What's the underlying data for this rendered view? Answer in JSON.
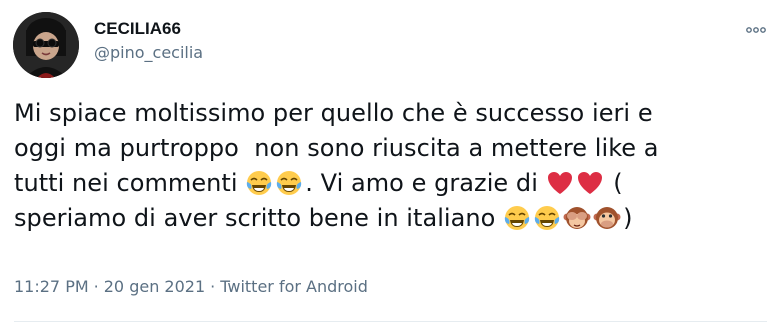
{
  "tweet": {
    "author": {
      "display_name": "CECILIA66",
      "handle": "@pino_cecilia",
      "avatar_icon": "avatar-icon"
    },
    "text_segments": {
      "line1": "Mi spiace moltissimo per quello che è successo ieri e",
      "line2": "oggi ma purtroppo  non sono riuscita a mettere like a",
      "line3a": "tutti nei commenti ",
      "line3b": ". Vi amo e grazie di ",
      "line3c": " (",
      "line4a": "speriamo di aver scritto bene in italiano ",
      "line4b": ")"
    },
    "emoji_icons": {
      "tears_of_joy": "face-with-tears-of-joy-icon",
      "red_heart": "red-heart-icon",
      "see_no_evil_monkey": "see-no-evil-monkey-icon",
      "speak_no_evil_monkey": "speak-no-evil-monkey-icon",
      "more": "more-options-icon"
    },
    "meta": {
      "time": "11:27 PM",
      "separator": "·",
      "date": "20 gen 2021",
      "source": "Twitter for Android"
    },
    "colors": {
      "text": "#0f1419",
      "secondary": "#5b7083",
      "heart": "#dd2e44",
      "emoji_yellow": "#ffcc4d"
    }
  }
}
